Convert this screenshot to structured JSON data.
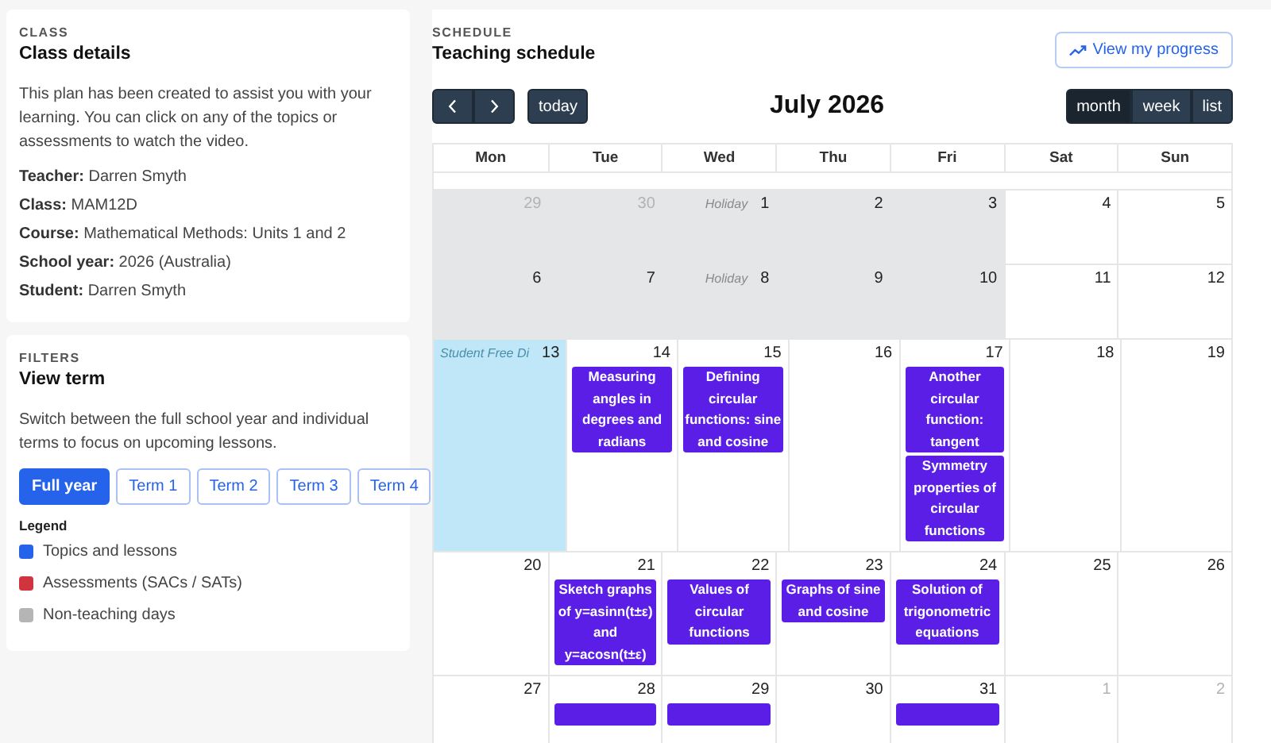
{
  "class_card": {
    "eyebrow": "CLASS",
    "title": "Class details",
    "intro": "This plan has been created to assist you with your learning. You can click on any of the topics or assessments to watch the video.",
    "details": [
      {
        "label": "Teacher:",
        "value": "Darren Smyth"
      },
      {
        "label": "Class:",
        "value": "MAM12D"
      },
      {
        "label": "Course:",
        "value": "Mathematical Methods: Units 1 and 2"
      },
      {
        "label": "School year:",
        "value": "2026 (Australia)"
      },
      {
        "label": "Student:",
        "value": "Darren Smyth"
      }
    ]
  },
  "filters": {
    "eyebrow": "FILTERS",
    "title": "View term",
    "intro": "Switch between the full school year and individual terms to focus on upcoming lessons.",
    "terms": [
      {
        "label": "Full year",
        "selected": true
      },
      {
        "label": "Term 1",
        "selected": false
      },
      {
        "label": "Term 2",
        "selected": false
      },
      {
        "label": "Term 3",
        "selected": false
      },
      {
        "label": "Term 4",
        "selected": false
      }
    ],
    "legend_title": "Legend",
    "legend": [
      {
        "label": "Topics and lessons",
        "color": "#2563eb"
      },
      {
        "label": "Assessments (SACs / SATs)",
        "color": "#d0343f"
      },
      {
        "label": "Non-teaching days",
        "color": "#b5b5b5"
      }
    ]
  },
  "schedule": {
    "eyebrow": "SCHEDULE",
    "title": "Teaching schedule",
    "progress_button": "View my progress",
    "today_button": "today",
    "month_title": "July 2026",
    "views": [
      {
        "label": "month",
        "selected": true
      },
      {
        "label": "week",
        "selected": false
      },
      {
        "label": "list",
        "selected": false
      }
    ],
    "weekdays": [
      "Mon",
      "Tue",
      "Wed",
      "Thu",
      "Fri",
      "Sat",
      "Sun"
    ],
    "weeks": [
      [
        {
          "day": "29",
          "other_month": true,
          "non_teaching": true
        },
        {
          "day": "30",
          "other_month": true,
          "non_teaching": true
        },
        {
          "day": "1",
          "other_month": false,
          "non_teaching": true,
          "note": "Holiday"
        },
        {
          "day": "2",
          "other_month": false,
          "non_teaching": true
        },
        {
          "day": "3",
          "other_month": false,
          "non_teaching": true
        },
        {
          "day": "4",
          "other_month": false
        },
        {
          "day": "5",
          "other_month": false
        }
      ],
      [
        {
          "day": "6",
          "other_month": false,
          "non_teaching": true
        },
        {
          "day": "7",
          "other_month": false,
          "non_teaching": true
        },
        {
          "day": "8",
          "other_month": false,
          "non_teaching": true,
          "note": "Holiday"
        },
        {
          "day": "9",
          "other_month": false,
          "non_teaching": true
        },
        {
          "day": "10",
          "other_month": false,
          "non_teaching": true
        },
        {
          "day": "11",
          "other_month": false
        },
        {
          "day": "12",
          "other_month": false
        }
      ],
      [
        {
          "day": "13",
          "other_month": false,
          "student_free": true,
          "note": "Student Free Di"
        },
        {
          "day": "14",
          "other_month": false,
          "events": [
            {
              "title": "Measuring angles in degrees and radians"
            }
          ]
        },
        {
          "day": "15",
          "other_month": false,
          "events": [
            {
              "title": "Defining circular functions: sine and cosine"
            }
          ]
        },
        {
          "day": "16",
          "other_month": false
        },
        {
          "day": "17",
          "other_month": false,
          "events": [
            {
              "title": "Another circular function: tangent"
            },
            {
              "title": "Symmetry properties of circular functions"
            }
          ]
        },
        {
          "day": "18",
          "other_month": false
        },
        {
          "day": "19",
          "other_month": false
        }
      ],
      [
        {
          "day": "20",
          "other_month": false
        },
        {
          "day": "21",
          "other_month": false,
          "events": [
            {
              "title": "Sketch graphs of y=asinn(t±ε) and y=acosn(t±ε)"
            }
          ]
        },
        {
          "day": "22",
          "other_month": false,
          "events": [
            {
              "title": "Values of circular functions"
            }
          ]
        },
        {
          "day": "23",
          "other_month": false,
          "events": [
            {
              "title": "Graphs of sine and cosine"
            }
          ]
        },
        {
          "day": "24",
          "other_month": false,
          "events": [
            {
              "title": "Solution of trigonometric equations"
            }
          ]
        },
        {
          "day": "25",
          "other_month": false
        },
        {
          "day": "26",
          "other_month": false
        }
      ],
      [
        {
          "day": "27",
          "other_month": false
        },
        {
          "day": "28",
          "other_month": false,
          "events": [
            {
              "cut_off": true
            }
          ]
        },
        {
          "day": "29",
          "other_month": false,
          "events": [
            {
              "cut_off": true
            }
          ]
        },
        {
          "day": "30",
          "other_month": false
        },
        {
          "day": "31",
          "other_month": false,
          "events": [
            {
              "cut_off": true
            }
          ]
        },
        {
          "day": "1",
          "other_month": true
        },
        {
          "day": "2",
          "other_month": true
        }
      ]
    ]
  }
}
